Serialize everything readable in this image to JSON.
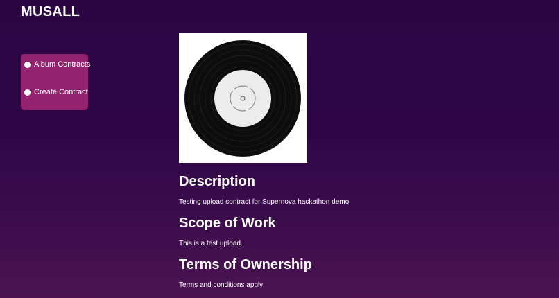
{
  "app": {
    "brand": "MUSALL"
  },
  "sidebar": {
    "items": [
      {
        "label": "Album Contracts",
        "icon": "dot-icon"
      },
      {
        "label": "Create Contract",
        "icon": "dot-icon"
      }
    ]
  },
  "album": {
    "cover_icon": "vinyl-record-icon"
  },
  "sections": {
    "description": {
      "heading": "Description",
      "text": "Testing upload contract for Supernova hackathon demo"
    },
    "scope": {
      "heading": "Scope of Work",
      "text": "This is a test upload."
    },
    "terms": {
      "heading": "Terms of Ownership",
      "text": "Terms and conditions apply"
    }
  },
  "colors": {
    "background_top": "#2b0542",
    "background_bottom": "#4a1350",
    "sidebar_bg": "#93236f",
    "text": "#ffffff"
  }
}
